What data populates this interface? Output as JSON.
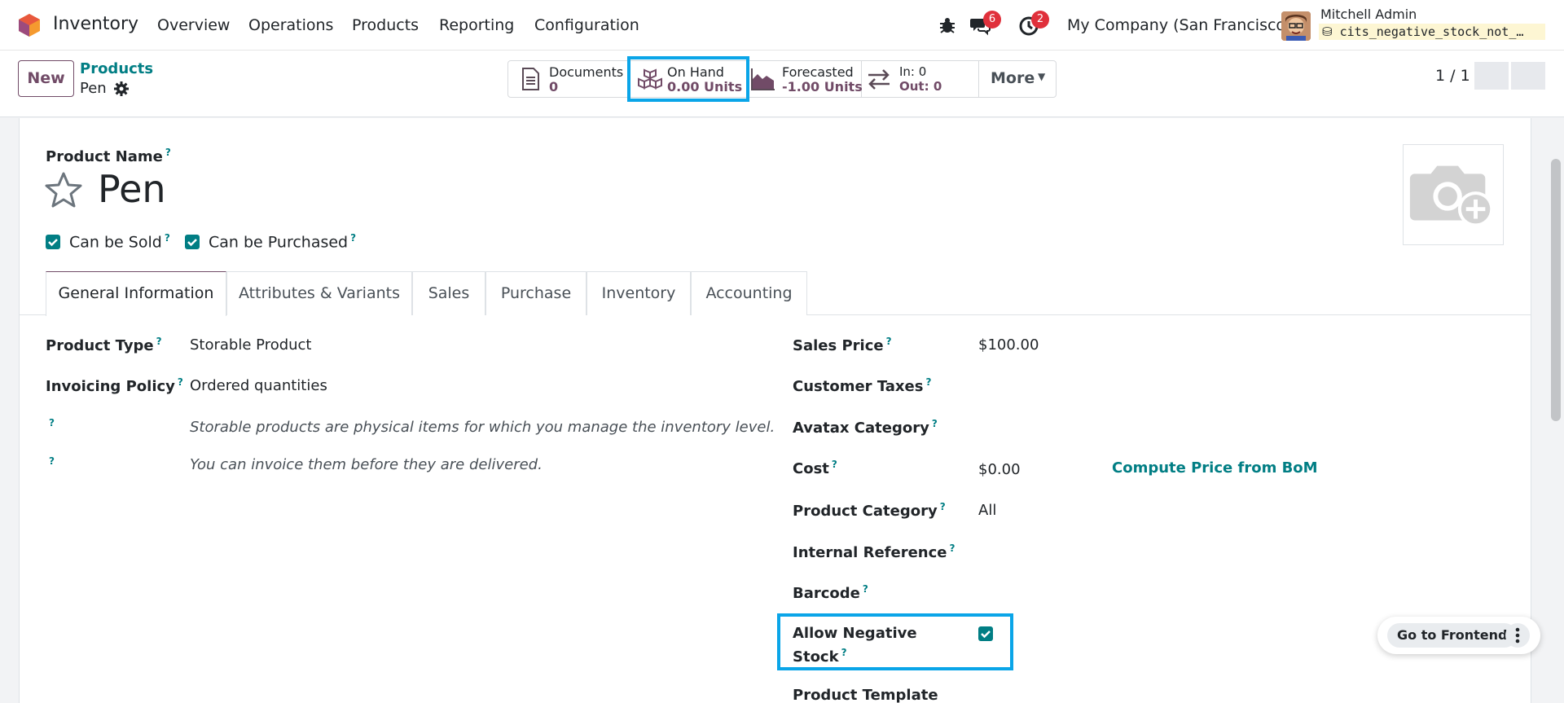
{
  "topbar": {
    "app_name": "Inventory",
    "menu": [
      "Overview",
      "Operations",
      "Products",
      "Reporting",
      "Configuration"
    ],
    "messages_badge": "6",
    "activities_badge": "2",
    "company": "My Company (San Francisco)",
    "user_name": "Mitchell Admin",
    "database": "cits_negative_stock_not_…"
  },
  "controlbar": {
    "new_label": "New",
    "breadcrumb_parent": "Products",
    "breadcrumb_current": "Pen",
    "pager": "1 / 1",
    "smart_buttons": {
      "documents_label": "Documents",
      "documents_value": "0",
      "on_hand_label": "On Hand",
      "on_hand_value": "0.00 Units",
      "forecasted_label": "Forecasted",
      "forecasted_value": "-1.00 Units",
      "in_label": "In: 0",
      "out_label": "Out: 0",
      "more_label": "More"
    }
  },
  "form": {
    "product_name_label": "Product Name",
    "product_name": "Pen",
    "can_be_sold": "Can be Sold",
    "can_be_purchased": "Can be Purchased",
    "tabs": [
      "General Information",
      "Attributes & Variants",
      "Sales",
      "Purchase",
      "Inventory",
      "Accounting"
    ],
    "left": {
      "product_type_label": "Product Type",
      "product_type": "Storable Product",
      "invoicing_policy_label": "Invoicing Policy",
      "invoicing_policy": "Ordered quantities",
      "help1": "Storable products are physical items for which you manage the inventory level.",
      "help2": "You can invoice them before they are delivered."
    },
    "right": {
      "sales_price_label": "Sales Price",
      "sales_price": "$100.00",
      "customer_taxes_label": "Customer Taxes",
      "avatax_label": "Avatax Category",
      "cost_label": "Cost",
      "cost": "$0.00",
      "compute_price": "Compute Price from BoM",
      "category_label": "Product Category",
      "category": "All",
      "internal_ref_label": "Internal Reference",
      "barcode_label": "Barcode",
      "allow_neg_line1": "Allow Negative",
      "allow_neg_line2": "Stock",
      "product_template_label": "Product Template"
    }
  },
  "floating": {
    "go_frontend": "Go to Frontend"
  },
  "colors": {
    "brand": "#714b67",
    "teal": "#017e84",
    "highlight": "#0aa5e8",
    "badge": "#e0303b"
  }
}
